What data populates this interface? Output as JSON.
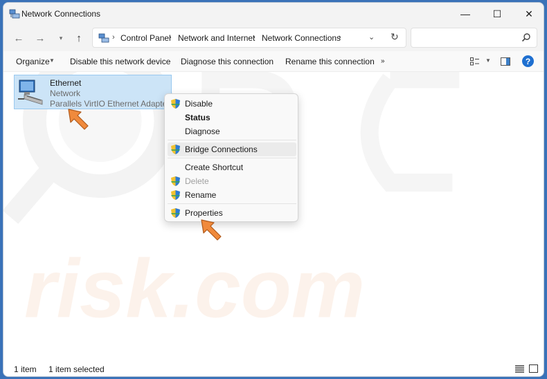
{
  "window": {
    "title": "Network Connections"
  },
  "titlebar": {
    "minimize": "—",
    "maximize": "☐",
    "close": "✕"
  },
  "address": {
    "crumbs": [
      "Control Panel",
      "Network and Internet",
      "Network Connections"
    ],
    "search_placeholder": ""
  },
  "commands": {
    "organize": "Organize",
    "disable": "Disable this network device",
    "diagnose": "Diagnose this connection",
    "rename": "Rename this connection",
    "more": "»"
  },
  "connection": {
    "name": "Ethernet",
    "status": "Network",
    "adapter": "Parallels VirtIO Ethernet Adapter",
    "selected": true
  },
  "context_menu": {
    "items": [
      {
        "label": "Disable",
        "shield": true,
        "bold": false,
        "disabled": false
      },
      {
        "label": "Status",
        "shield": false,
        "bold": true,
        "disabled": false
      },
      {
        "label": "Diagnose",
        "shield": false,
        "bold": false,
        "disabled": false
      },
      {
        "label": "Bridge Connections",
        "shield": true,
        "bold": false,
        "disabled": false
      },
      {
        "label": "Create Shortcut",
        "shield": false,
        "bold": false,
        "disabled": false
      },
      {
        "label": "Delete",
        "shield": true,
        "bold": false,
        "disabled": true
      },
      {
        "label": "Rename",
        "shield": true,
        "bold": false,
        "disabled": false
      },
      {
        "label": "Properties",
        "shield": true,
        "bold": false,
        "disabled": false
      }
    ]
  },
  "statusbar": {
    "count": "1 item",
    "selected": "1 item selected"
  },
  "colors": {
    "selection_bg": "#cce4f7",
    "selection_border": "#99c9ef",
    "arrow": "#f08a3c",
    "accent": "#1e6fd0"
  },
  "watermark": {
    "text": "risk.com"
  }
}
